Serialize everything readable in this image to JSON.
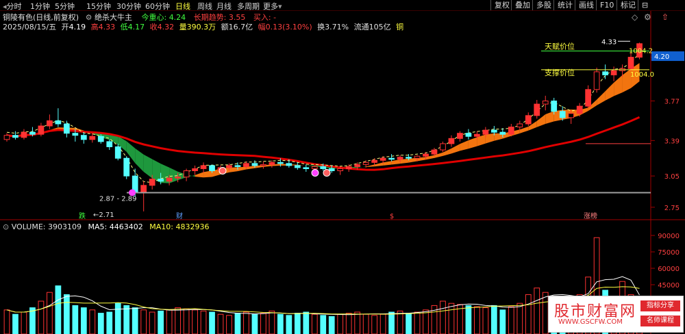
{
  "topbar": {
    "timeframes": [
      "分时",
      "1分钟",
      "5分钟",
      "15分钟",
      "30分钟",
      "60分钟",
      "日线",
      "周线",
      "月线",
      "多周期",
      "更多"
    ],
    "active_timeframe": "日线",
    "buttons": [
      "复权",
      "叠加",
      "多股",
      "统计",
      "画线",
      "F10",
      "标记",
      "⊟"
    ]
  },
  "header": {
    "stock_name": "铜陵有色(日线,前复权)",
    "indicator_name": "绝杀大牛主",
    "metric1_label": "今重心:",
    "metric1_value": "4.24",
    "metric2_label": "长期趋势:",
    "metric2_value": "3.55",
    "metric3_label": "买入:",
    "metric3_value": "-"
  },
  "quote": {
    "date": "2025/08/15/五",
    "open_label": "开",
    "open": "4.19",
    "high_label": "高",
    "high": "4.33",
    "low_label": "低",
    "low": "4.17",
    "close_label": "收",
    "close": "4.32",
    "vol_label": "量",
    "volume": "390.3万",
    "amount_label": "额",
    "amount": "16.7亿",
    "change_label": "幅",
    "change": "0.13(3.10%)",
    "turnover_label": "换",
    "turnover": "3.71%",
    "float_label": "流通",
    "float_cap": "105亿",
    "industry": "铜"
  },
  "colors": {
    "up": "#ff3232",
    "down": "#54ffff",
    "ma_red": "#e00000",
    "band_orange": "#ff7a10",
    "band_green": "#20a040",
    "dash_yellow": "#ffff80",
    "axis": "#a00000"
  },
  "annotations": {
    "resistance_label": "天赋价位",
    "support_label": "支撑价位",
    "resistance_value": "1004.2",
    "support_value": "1004.0",
    "peak_label": "4.33",
    "low_range": "2.87 - 2.89",
    "low_mark": "2.71",
    "current_price": "4.20",
    "bottom_tags": [
      "跌",
      "财",
      "$",
      "涨榜"
    ]
  },
  "volume_info": {
    "title": "VOLUME:",
    "volume": "3903109",
    "ma5_label": "MA5:",
    "ma5": "4463402",
    "ma10_label": "MA10:",
    "ma10": "4832936"
  },
  "watermark": {
    "title": "股市财富网",
    "url": "WWW.GSCFW.COM",
    "tag1": "指标分享",
    "tag2": "名师课程"
  },
  "chart_data": [
    {
      "type": "candlestick",
      "yticks": [
        4.19,
        3.77,
        3.39,
        3.05,
        2.75
      ],
      "ylim": [
        2.65,
        4.45
      ],
      "last_close": 4.32,
      "ohlc": [
        [
          3.4,
          3.46,
          3.38,
          3.44
        ],
        [
          3.44,
          3.48,
          3.4,
          3.42
        ],
        [
          3.42,
          3.5,
          3.4,
          3.47
        ],
        [
          3.47,
          3.52,
          3.43,
          3.45
        ],
        [
          3.45,
          3.56,
          3.43,
          3.53
        ],
        [
          3.53,
          3.64,
          3.5,
          3.58
        ],
        [
          3.58,
          3.7,
          3.52,
          3.55
        ],
        [
          3.55,
          3.58,
          3.42,
          3.46
        ],
        [
          3.46,
          3.5,
          3.38,
          3.44
        ],
        [
          3.44,
          3.47,
          3.36,
          3.4
        ],
        [
          3.4,
          3.46,
          3.37,
          3.43
        ],
        [
          3.43,
          3.45,
          3.36,
          3.38
        ],
        [
          3.38,
          3.4,
          3.3,
          3.33
        ],
        [
          3.33,
          3.36,
          3.2,
          3.22
        ],
        [
          3.22,
          3.24,
          3.02,
          3.05
        ],
        [
          3.05,
          3.12,
          2.85,
          2.89
        ],
        [
          2.89,
          3.0,
          2.71,
          2.96
        ],
        [
          2.96,
          3.06,
          2.92,
          3.02
        ],
        [
          3.02,
          3.08,
          2.97,
          3.0
        ],
        [
          3.0,
          3.06,
          2.96,
          3.03
        ],
        [
          3.03,
          3.08,
          2.99,
          3.04
        ],
        [
          3.04,
          3.12,
          3.0,
          3.1
        ],
        [
          3.1,
          3.15,
          3.06,
          3.12
        ],
        [
          3.12,
          3.18,
          3.08,
          3.15
        ],
        [
          3.15,
          3.16,
          3.08,
          3.1
        ],
        [
          3.1,
          3.15,
          3.07,
          3.13
        ],
        [
          3.13,
          3.17,
          3.1,
          3.15
        ],
        [
          3.15,
          3.18,
          3.11,
          3.14
        ],
        [
          3.14,
          3.19,
          3.12,
          3.17
        ],
        [
          3.17,
          3.2,
          3.13,
          3.15
        ],
        [
          3.15,
          3.19,
          3.12,
          3.16
        ],
        [
          3.16,
          3.2,
          3.13,
          3.18
        ],
        [
          3.18,
          3.22,
          3.14,
          3.17
        ],
        [
          3.17,
          3.21,
          3.13,
          3.15
        ],
        [
          3.15,
          3.18,
          3.11,
          3.13
        ],
        [
          3.13,
          3.16,
          3.09,
          3.12
        ],
        [
          3.12,
          3.15,
          3.08,
          3.14
        ],
        [
          3.14,
          3.17,
          3.1,
          3.12
        ],
        [
          3.12,
          3.15,
          3.08,
          3.1
        ],
        [
          3.1,
          3.14,
          3.06,
          3.12
        ],
        [
          3.12,
          3.16,
          3.09,
          3.14
        ],
        [
          3.14,
          3.18,
          3.11,
          3.16
        ],
        [
          3.16,
          3.2,
          3.13,
          3.18
        ],
        [
          3.18,
          3.22,
          3.15,
          3.2
        ],
        [
          3.2,
          3.24,
          3.17,
          3.22
        ],
        [
          3.22,
          3.26,
          3.19,
          3.21
        ],
        [
          3.21,
          3.25,
          3.18,
          3.23
        ],
        [
          3.23,
          3.26,
          3.2,
          3.22
        ],
        [
          3.22,
          3.25,
          3.19,
          3.24
        ],
        [
          3.24,
          3.28,
          3.21,
          3.26
        ],
        [
          3.26,
          3.32,
          3.24,
          3.3
        ],
        [
          3.3,
          3.38,
          3.28,
          3.36
        ],
        [
          3.36,
          3.44,
          3.33,
          3.41
        ],
        [
          3.41,
          3.48,
          3.38,
          3.46
        ],
        [
          3.46,
          3.5,
          3.4,
          3.43
        ],
        [
          3.43,
          3.48,
          3.4,
          3.45
        ],
        [
          3.45,
          3.52,
          3.42,
          3.49
        ],
        [
          3.49,
          3.53,
          3.44,
          3.47
        ],
        [
          3.47,
          3.51,
          3.42,
          3.45
        ],
        [
          3.45,
          3.55,
          3.43,
          3.52
        ],
        [
          3.52,
          3.58,
          3.49,
          3.55
        ],
        [
          3.55,
          3.66,
          3.53,
          3.63
        ],
        [
          3.63,
          3.78,
          3.6,
          3.74
        ],
        [
          3.74,
          3.82,
          3.68,
          3.77
        ],
        [
          3.77,
          3.8,
          3.64,
          3.67
        ],
        [
          3.67,
          3.72,
          3.58,
          3.61
        ],
        [
          3.61,
          3.68,
          3.55,
          3.65
        ],
        [
          3.65,
          3.75,
          3.62,
          3.72
        ],
        [
          3.72,
          3.92,
          3.7,
          3.88
        ],
        [
          3.88,
          4.09,
          3.85,
          4.05
        ],
        [
          4.05,
          4.12,
          3.98,
          4.02
        ],
        [
          4.02,
          4.1,
          3.96,
          4.06
        ],
        [
          4.06,
          4.12,
          4.0,
          4.08
        ],
        [
          4.08,
          4.25,
          4.06,
          4.19
        ],
        [
          4.19,
          4.33,
          4.17,
          4.32
        ]
      ],
      "volume_ma5_ma10_ylim": [
        0,
        95000
      ],
      "volume_yticks": [
        90000,
        75000,
        60000,
        45000
      ],
      "volumes": [
        22000,
        18000,
        20000,
        24000,
        30000,
        38000,
        44000,
        36000,
        26000,
        24000,
        22000,
        19000,
        20000,
        28000,
        26000,
        24000,
        22000,
        20000,
        21000,
        22000,
        24000,
        23000,
        22000,
        21000,
        20000,
        18000,
        17000,
        19000,
        20000,
        18000,
        19000,
        21000,
        18000,
        17000,
        19000,
        20000,
        18000,
        17000,
        16000,
        18000,
        19000,
        20000,
        18000,
        17000,
        18000,
        20000,
        21000,
        19000,
        20000,
        22000,
        26000,
        30000,
        28000,
        27000,
        26000,
        25000,
        24000,
        26000,
        22000,
        25000,
        28000,
        36000,
        42000,
        38000,
        34000,
        30000,
        32000,
        36000,
        52000,
        88000,
        40000,
        34000,
        48000,
        36000,
        20000
      ]
    }
  ]
}
